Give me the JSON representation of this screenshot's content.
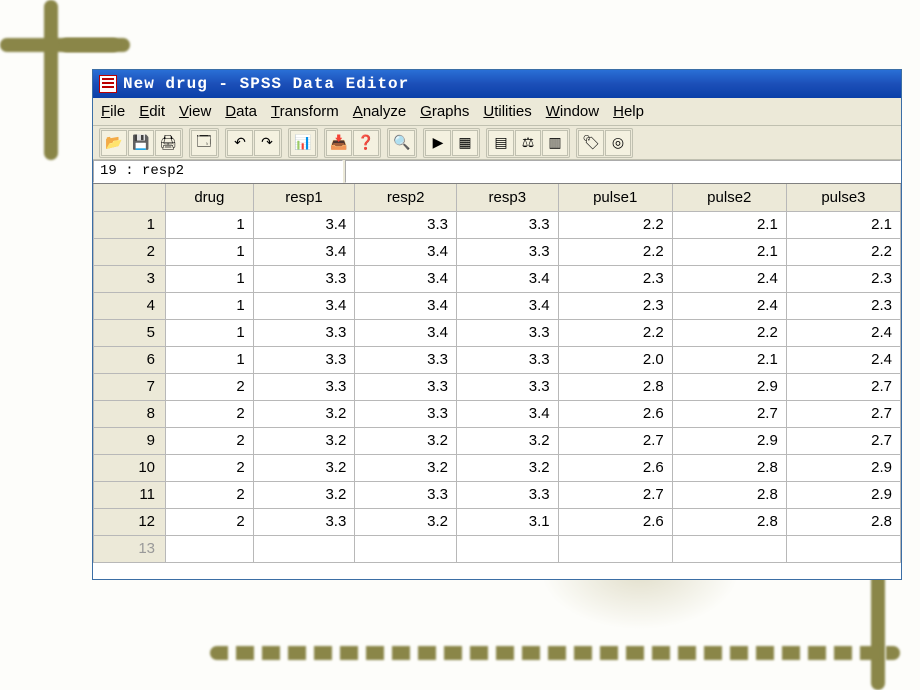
{
  "window": {
    "title": "New drug - SPSS Data Editor"
  },
  "menubar": [
    {
      "label": "File",
      "u": "F"
    },
    {
      "label": "Edit",
      "u": "E"
    },
    {
      "label": "View",
      "u": "V"
    },
    {
      "label": "Data",
      "u": "D"
    },
    {
      "label": "Transform",
      "u": "T"
    },
    {
      "label": "Analyze",
      "u": "A"
    },
    {
      "label": "Graphs",
      "u": "G"
    },
    {
      "label": "Utilities",
      "u": "U"
    },
    {
      "label": "Window",
      "u": "W"
    },
    {
      "label": "Help",
      "u": "H"
    }
  ],
  "toolbar_groups": [
    [
      "open-icon",
      "save-icon",
      "print-icon"
    ],
    [
      "dialog-recall-icon"
    ],
    [
      "undo-icon",
      "redo-icon"
    ],
    [
      "goto-chart-icon"
    ],
    [
      "goto-case-icon",
      "variables-icon"
    ],
    [
      "find-icon"
    ],
    [
      "insert-case-icon",
      "insert-var-icon"
    ],
    [
      "split-file-icon",
      "weight-icon",
      "select-cases-icon"
    ],
    [
      "value-labels-icon",
      "use-sets-icon"
    ]
  ],
  "toolbar_glyphs": {
    "open-icon": "📂",
    "save-icon": "💾",
    "print-icon": "🖨",
    "dialog-recall-icon": "🗔",
    "undo-icon": "↶",
    "redo-icon": "↷",
    "goto-chart-icon": "📊",
    "goto-case-icon": "📥",
    "variables-icon": "❓",
    "find-icon": "🔍",
    "insert-case-icon": "▶",
    "insert-var-icon": "▦",
    "split-file-icon": "▤",
    "weight-icon": "⚖",
    "select-cases-icon": "▥",
    "value-labels-icon": "🏷",
    "use-sets-icon": "◎"
  },
  "cell_reference": "19 : resp2",
  "columns": [
    "drug",
    "resp1",
    "resp2",
    "resp3",
    "pulse1",
    "pulse2",
    "pulse3"
  ],
  "rows": [
    {
      "n": "1",
      "drug": "1",
      "resp1": "3.4",
      "resp2": "3.3",
      "resp3": "3.3",
      "pulse1": "2.2",
      "pulse2": "2.1",
      "pulse3": "2.1"
    },
    {
      "n": "2",
      "drug": "1",
      "resp1": "3.4",
      "resp2": "3.4",
      "resp3": "3.3",
      "pulse1": "2.2",
      "pulse2": "2.1",
      "pulse3": "2.2"
    },
    {
      "n": "3",
      "drug": "1",
      "resp1": "3.3",
      "resp2": "3.4",
      "resp3": "3.4",
      "pulse1": "2.3",
      "pulse2": "2.4",
      "pulse3": "2.3"
    },
    {
      "n": "4",
      "drug": "1",
      "resp1": "3.4",
      "resp2": "3.4",
      "resp3": "3.4",
      "pulse1": "2.3",
      "pulse2": "2.4",
      "pulse3": "2.3"
    },
    {
      "n": "5",
      "drug": "1",
      "resp1": "3.3",
      "resp2": "3.4",
      "resp3": "3.3",
      "pulse1": "2.2",
      "pulse2": "2.2",
      "pulse3": "2.4"
    },
    {
      "n": "6",
      "drug": "1",
      "resp1": "3.3",
      "resp2": "3.3",
      "resp3": "3.3",
      "pulse1": "2.0",
      "pulse2": "2.1",
      "pulse3": "2.4"
    },
    {
      "n": "7",
      "drug": "2",
      "resp1": "3.3",
      "resp2": "3.3",
      "resp3": "3.3",
      "pulse1": "2.8",
      "pulse2": "2.9",
      "pulse3": "2.7"
    },
    {
      "n": "8",
      "drug": "2",
      "resp1": "3.2",
      "resp2": "3.3",
      "resp3": "3.4",
      "pulse1": "2.6",
      "pulse2": "2.7",
      "pulse3": "2.7"
    },
    {
      "n": "9",
      "drug": "2",
      "resp1": "3.2",
      "resp2": "3.2",
      "resp3": "3.2",
      "pulse1": "2.7",
      "pulse2": "2.9",
      "pulse3": "2.7"
    },
    {
      "n": "10",
      "drug": "2",
      "resp1": "3.2",
      "resp2": "3.2",
      "resp3": "3.2",
      "pulse1": "2.6",
      "pulse2": "2.8",
      "pulse3": "2.9"
    },
    {
      "n": "11",
      "drug": "2",
      "resp1": "3.2",
      "resp2": "3.3",
      "resp3": "3.3",
      "pulse1": "2.7",
      "pulse2": "2.8",
      "pulse3": "2.9"
    },
    {
      "n": "12",
      "drug": "2",
      "resp1": "3.3",
      "resp2": "3.2",
      "resp3": "3.1",
      "pulse1": "2.6",
      "pulse2": "2.8",
      "pulse3": "2.8"
    }
  ],
  "empty_row": "13"
}
